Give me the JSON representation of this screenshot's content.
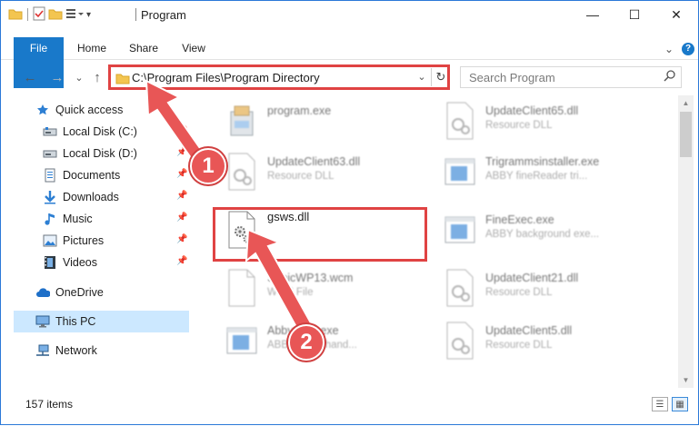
{
  "window": {
    "title": "Program"
  },
  "window_controls": {
    "minimize": "—",
    "maximize": "☐",
    "close": "✕"
  },
  "ribbon": {
    "tabs": [
      {
        "label": "File"
      },
      {
        "label": "Home"
      },
      {
        "label": "Share"
      },
      {
        "label": "View"
      }
    ],
    "collapse_glyph": "⌄",
    "help_glyph": "?"
  },
  "nav": {
    "back_glyph": "←",
    "forward_glyph": "→",
    "recent_glyph": "⌄",
    "up_glyph": "↑",
    "address_path": "C:\\Program Files\\Program Directory",
    "dropdown_glyph": "⌄",
    "refresh_glyph": "↻",
    "search_placeholder": "Search Program",
    "search_glyph": "⚲"
  },
  "sidebar": {
    "items": [
      {
        "label": "Quick access",
        "icon": "star-icon",
        "pinned": false,
        "selected": false
      },
      {
        "label": "Local Disk (C:)",
        "icon": "drive-icon",
        "pinned": true,
        "selected": false
      },
      {
        "label": "Local Disk (D:)",
        "icon": "drive-icon",
        "pinned": true,
        "selected": false
      },
      {
        "label": "Documents",
        "icon": "documents-icon",
        "pinned": true,
        "selected": false
      },
      {
        "label": "Downloads",
        "icon": "download-icon",
        "pinned": true,
        "selected": false
      },
      {
        "label": "Music",
        "icon": "music-icon",
        "pinned": true,
        "selected": false
      },
      {
        "label": "Pictures",
        "icon": "pictures-icon",
        "pinned": true,
        "selected": false
      },
      {
        "label": "Videos",
        "icon": "videos-icon",
        "pinned": true,
        "selected": false
      },
      {
        "label": "OneDrive",
        "icon": "cloud-icon",
        "pinned": false,
        "selected": false
      },
      {
        "label": "This PC",
        "icon": "computer-icon",
        "pinned": false,
        "selected": true
      },
      {
        "label": "Network",
        "icon": "network-icon",
        "pinned": false,
        "selected": false
      }
    ],
    "pin_glyph": "📌"
  },
  "files": [
    {
      "name": "program.exe",
      "desc": "",
      "icon": "installer-icon"
    },
    {
      "name": "UpdateClient65.dll",
      "desc": "Resource DLL",
      "icon": "dll-icon"
    },
    {
      "name": "UpdateClient63.dll",
      "desc": "Resource DLL",
      "icon": "dll-icon"
    },
    {
      "name": "Trigrammsinstaller.exe",
      "desc": "ABBY fineReader tri...",
      "icon": "app-window-icon"
    },
    {
      "name": "gsws.dll",
      "desc": "",
      "icon": "gear-file-icon"
    },
    {
      "name": "FineExec.exe",
      "desc": "ABBY background exe...",
      "icon": "app-window-icon"
    },
    {
      "name": "SonicWP13.wcm",
      "desc": "WCM File",
      "icon": "blank-file-icon"
    },
    {
      "name": "UpdateClient21.dll",
      "desc": "Resource DLL",
      "icon": "dll-icon"
    },
    {
      "name": "AbbyyInst.exe",
      "desc": "ABBY client hand...",
      "icon": "app-window-icon"
    },
    {
      "name": "UpdateClient5.dll",
      "desc": "Resource DLL",
      "icon": "dll-icon"
    }
  ],
  "status": {
    "item_count": "157 items"
  },
  "annotations": {
    "step1": "1",
    "step2": "2"
  },
  "colors": {
    "accent": "#1979ca",
    "highlight_red": "#e04343",
    "selected_bg": "#cce8ff"
  }
}
